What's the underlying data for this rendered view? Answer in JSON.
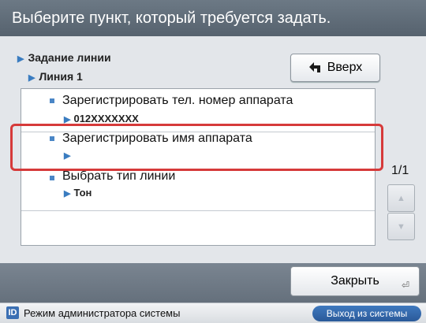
{
  "header": {
    "title": "Выберите пункт, который требуется задать."
  },
  "breadcrumb": {
    "level1": "Задание линии",
    "level2": "Линия 1"
  },
  "up_button": {
    "label": "Вверх"
  },
  "list": {
    "items": [
      {
        "title": "Зарегистрировать тел. номер аппарата",
        "value": "012XXXXXXX"
      },
      {
        "title": "Зарегистрировать имя аппарата",
        "value": ""
      },
      {
        "title": "Выбрать тип линии",
        "value": "Тон"
      }
    ],
    "selected_index": 1
  },
  "pager": {
    "indicator": "1/1"
  },
  "footer": {
    "close_label": "Закрыть"
  },
  "status_bar": {
    "mode_text": "Режим администратора системы",
    "logout_label": "Выход из системы"
  },
  "colors": {
    "highlight": "#d63a3a",
    "accent": "#3b6fb3"
  }
}
